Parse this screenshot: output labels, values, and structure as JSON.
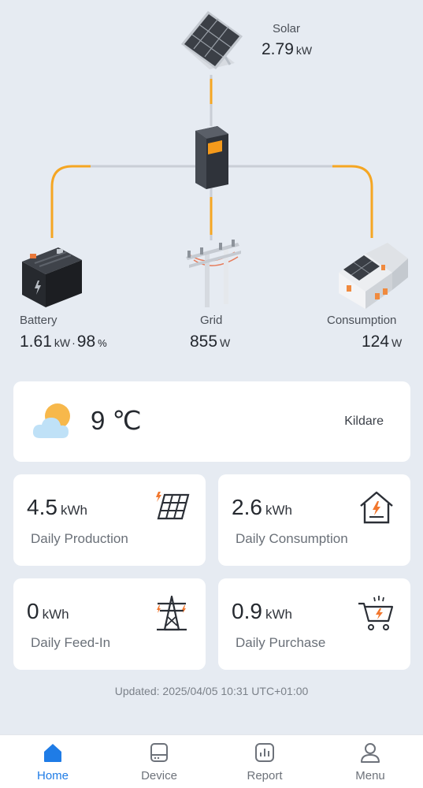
{
  "flow": {
    "solar": {
      "label": "Solar",
      "value": "2.79",
      "unit": "kW"
    },
    "battery": {
      "label": "Battery",
      "value": "1.61",
      "unit": "kW",
      "separator": "·",
      "soc": "98",
      "soc_unit": "%"
    },
    "grid": {
      "label": "Grid",
      "value": "855",
      "unit": "W"
    },
    "consumption": {
      "label": "Consumption",
      "value": "124",
      "unit": "W"
    }
  },
  "weather": {
    "temperature": "9 ℃",
    "location": "Kildare",
    "icon": "partly-cloudy-icon"
  },
  "stats": {
    "production": {
      "value": "4.5",
      "unit": "kWh",
      "label": "Daily Production",
      "icon": "solar-panel-icon"
    },
    "consumption": {
      "value": "2.6",
      "unit": "kWh",
      "label": "Daily Consumption",
      "icon": "home-energy-icon"
    },
    "feed_in": {
      "value": "0",
      "unit": "kWh",
      "label": "Daily Feed-In",
      "icon": "power-tower-icon"
    },
    "purchase": {
      "value": "0.9",
      "unit": "kWh",
      "label": "Daily Purchase",
      "icon": "cart-energy-icon"
    }
  },
  "updated": "Updated: 2025/04/05 10:31 UTC+01:00",
  "nav": {
    "home": "Home",
    "device": "Device",
    "report": "Report",
    "menu": "Menu"
  },
  "colors": {
    "accent": "#1f7ce6",
    "flow_active": "#f5a623",
    "flow_idle": "#c9ced6",
    "icon_orange": "#f2772e"
  }
}
